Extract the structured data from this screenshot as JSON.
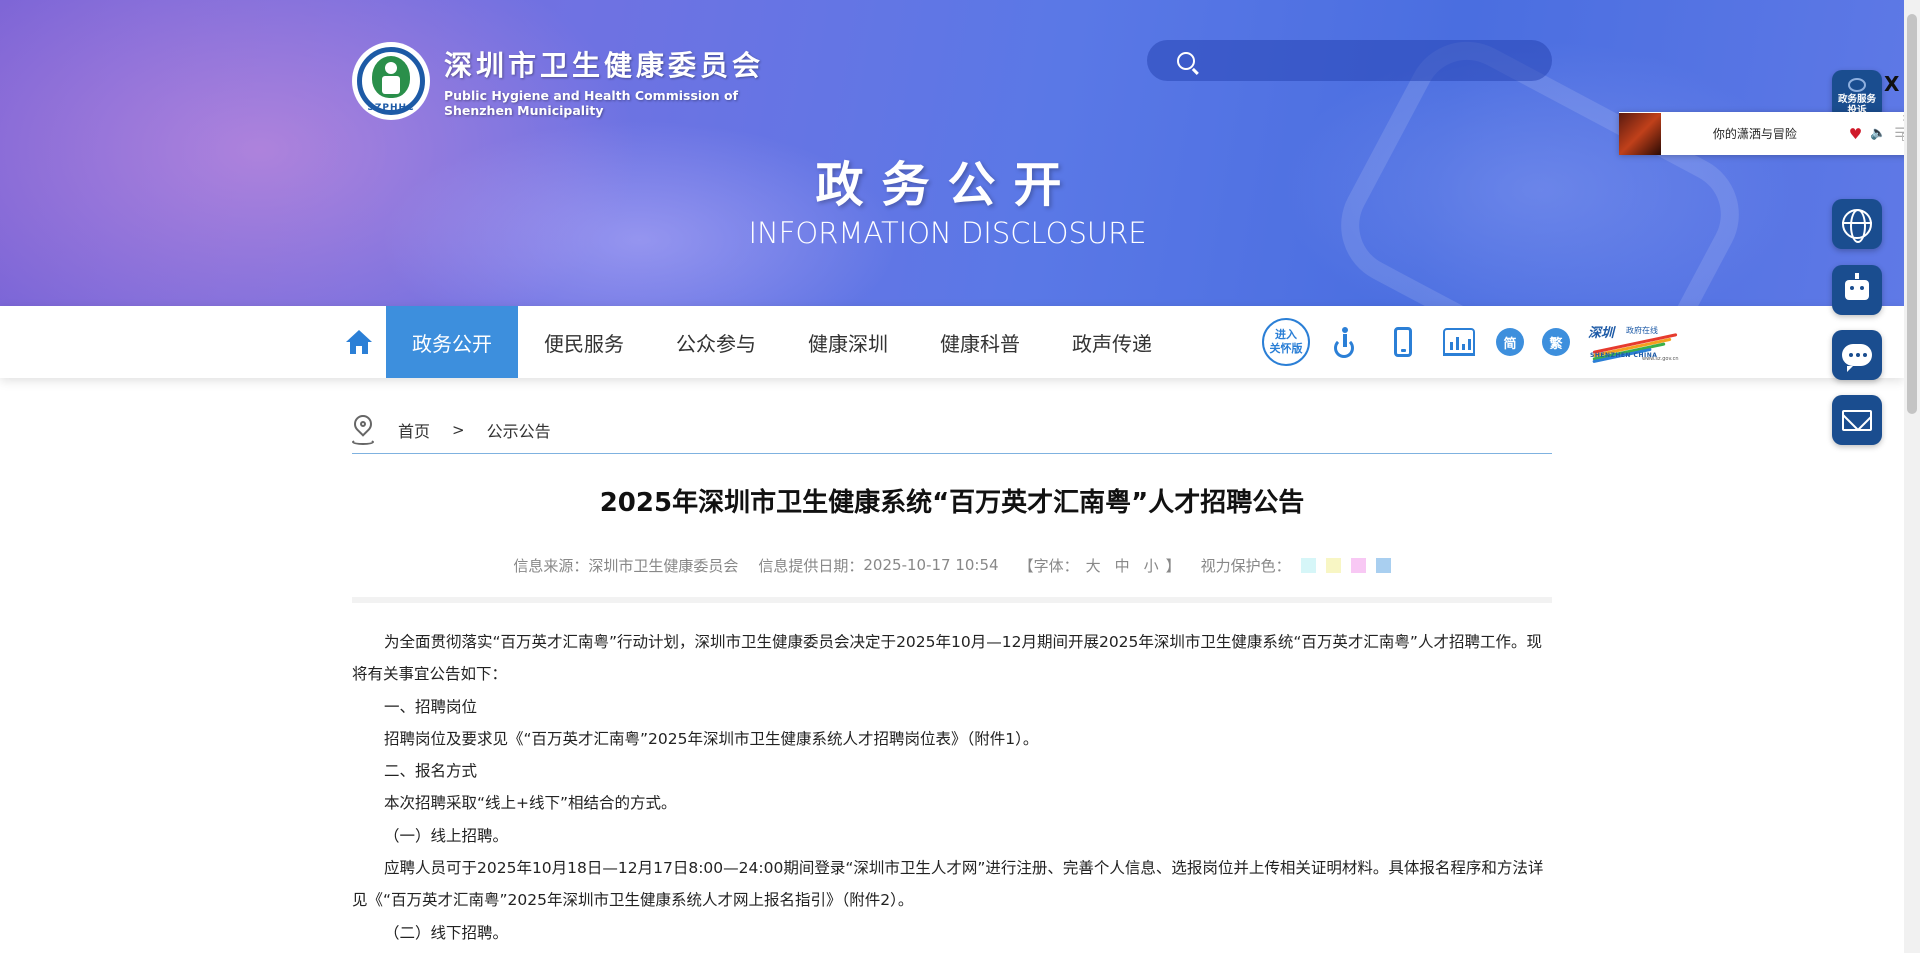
{
  "header": {
    "org_name_zh": "深圳市卫生健康委员会",
    "org_name_en": "Public Hygiene and Health Commission of Shenzhen Municipality",
    "badge_text": "SZPHHC",
    "section_title": "政务公开",
    "section_subtitle": "INFORMATION DISCLOSURE",
    "search": {
      "placeholder": ""
    }
  },
  "nav": {
    "items": [
      {
        "label": "政务公开",
        "active": true
      },
      {
        "label": "便民服务"
      },
      {
        "label": "公众参与"
      },
      {
        "label": "健康深圳"
      },
      {
        "label": "健康科普"
      },
      {
        "label": "政声传递"
      }
    ],
    "tools": {
      "care_mode_line1": "进入",
      "care_mode_line2": "关怀版",
      "simplified": "简",
      "traditional": "繁",
      "sz_logo_zh": "深圳",
      "sz_logo_sub": "政府在线",
      "sz_logo_en": "SHENZHEN CHINA",
      "sz_logo_url": "www.sz.gov.cn"
    }
  },
  "breadcrumb": {
    "home": "首页",
    "separator": ">",
    "current": "公示公告"
  },
  "article": {
    "title": "2025年深圳市卫生健康系统“百万英才汇南粤”人才招聘公告",
    "meta": {
      "source_label": "信息来源：",
      "source": "深圳市卫生健康委员会",
      "date_label": "信息提供日期：",
      "date": "2025-10-17 10:54",
      "font_label": "【字体：",
      "font_large": "大",
      "font_medium": "中",
      "font_small": "小",
      "font_close": "】",
      "eye_label": "视力保护色："
    },
    "paragraphs": [
      "为全面贯彻落实“百万英才汇南粤”行动计划，深圳市卫生健康委员会决定于2025年10月—12月期间开展2025年深圳市卫生健康系统“百万英才汇南粤”人才招聘工作。现将有关事宜公告如下：",
      "一、招聘岗位",
      "招聘岗位及要求见《“百万英才汇南粤”2025年深圳市卫生健康系统人才招聘岗位表》（附件1）。",
      "二、报名方式",
      "本次招聘采取“线上+线下”相结合的方式。",
      "（一）线上招聘。",
      "应聘人员可于2025年10月18日—12月17日8:00—24:00期间登录“深圳市卫生人才网”进行注册、完善个人信息、选报岗位并上传相关证明材料。具体报名程序和方法详见《“百万英才汇南粤”2025年深圳市卫生健康系统人才网上报名指引》（附件2）。",
      "（二）线下招聘。"
    ]
  },
  "float_bar": {
    "complaint_line1": "政务服务",
    "complaint_line2": "投诉",
    "close": "X"
  },
  "music_player": {
    "song": "你的潇洒与冒险",
    "close": "×"
  },
  "colors": {
    "accent": "#3d8fdd",
    "nav_active_bg": "#3d8fdd",
    "float_btn": "#1a4d8f",
    "swatches": [
      "#d6f6f8",
      "#f8f6c4",
      "#f8c8f4",
      "#a9cff0"
    ]
  },
  "icons": [
    "search-icon",
    "home-icon",
    "wheelchair-icon",
    "mobile-icon",
    "stats-icon",
    "location-pin-icon",
    "globe-icon",
    "robot-icon",
    "chat-icon",
    "mail-icon",
    "heart-icon",
    "volume-icon",
    "playlist-icon"
  ]
}
